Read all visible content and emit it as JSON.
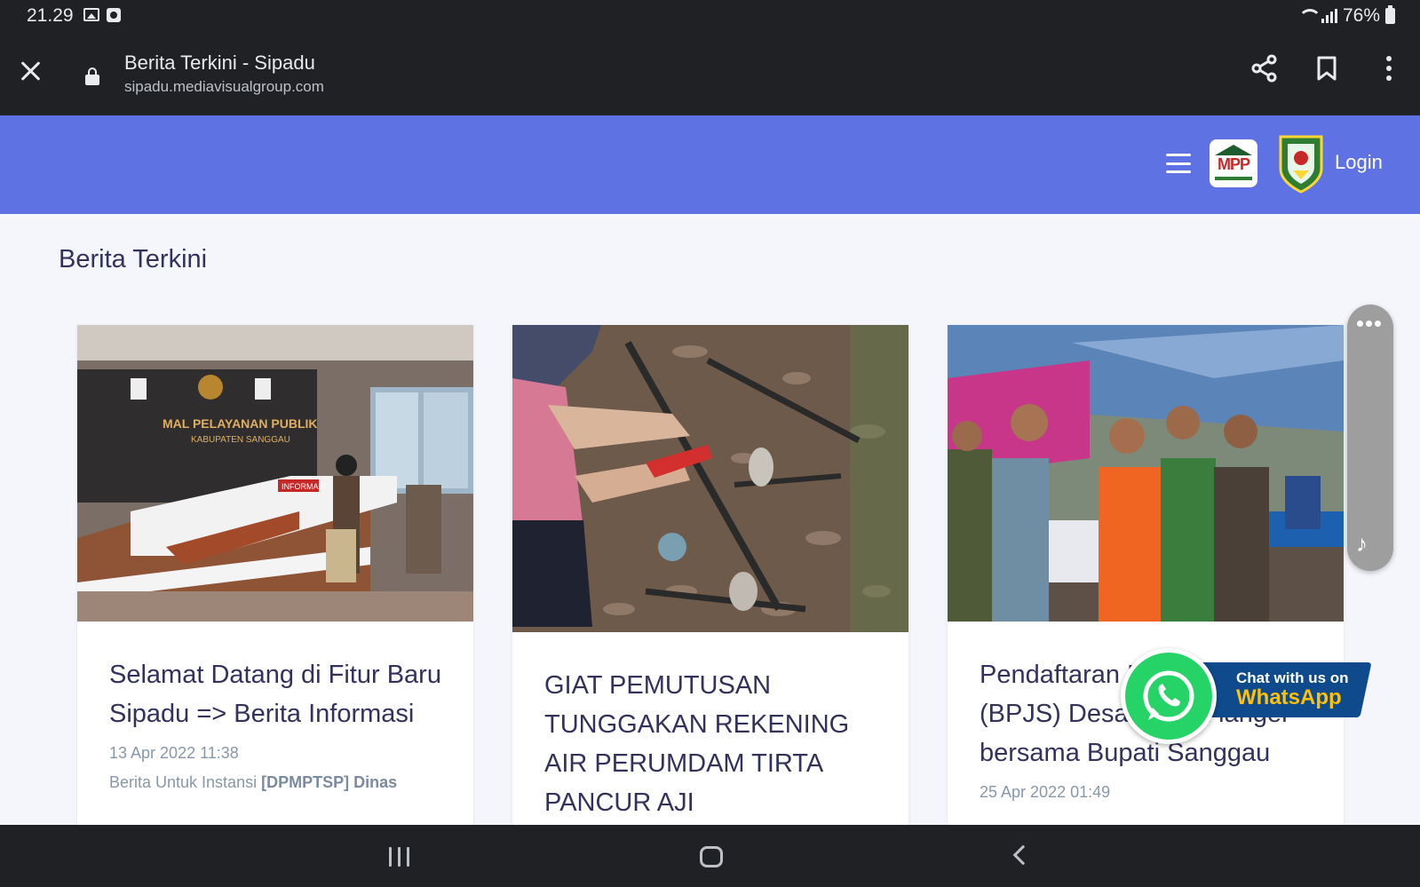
{
  "status_bar": {
    "time": "21.29",
    "battery": "76%"
  },
  "browser": {
    "title": "Berita Terkini - Sipadu",
    "url": "sipadu.mediavisualgroup.com"
  },
  "navbar": {
    "login_label": "Login",
    "logo_text": "MPP"
  },
  "page": {
    "section_title": "Berita Terkini",
    "cards": [
      {
        "title": "Selamat Datang di Fitur Baru Sipadu => Berita Informasi",
        "date": "13 Apr 2022 11:38",
        "meta_prefix": "Berita Untuk Instansi",
        "meta_agency": "[DPMPTSP] Dinas",
        "photo_sign_1": "MAL PELAYANAN PUBLIK",
        "photo_sign_2": "KABUPATEN SANGGAU",
        "photo_sign_3": "INFORMASI"
      },
      {
        "title": "GIAT PEMUTUSAN TUNGGAKAN REKENING AIR PERUMDAM TIRTA PANCUR AJI",
        "date": ""
      },
      {
        "title": "Pendaftaran Peserta Mandiri (BPJS) Desa sungai langer bersama Bupati Sanggau",
        "date": "25 Apr 2022 01:49"
      }
    ]
  },
  "whatsapp": {
    "line1": "Chat with us on",
    "line2": "WhatsApp"
  },
  "colors": {
    "navbar": "#5e72e4",
    "title": "#32325d",
    "whatsapp": "#25d366",
    "banner": "#0e4a8c"
  }
}
